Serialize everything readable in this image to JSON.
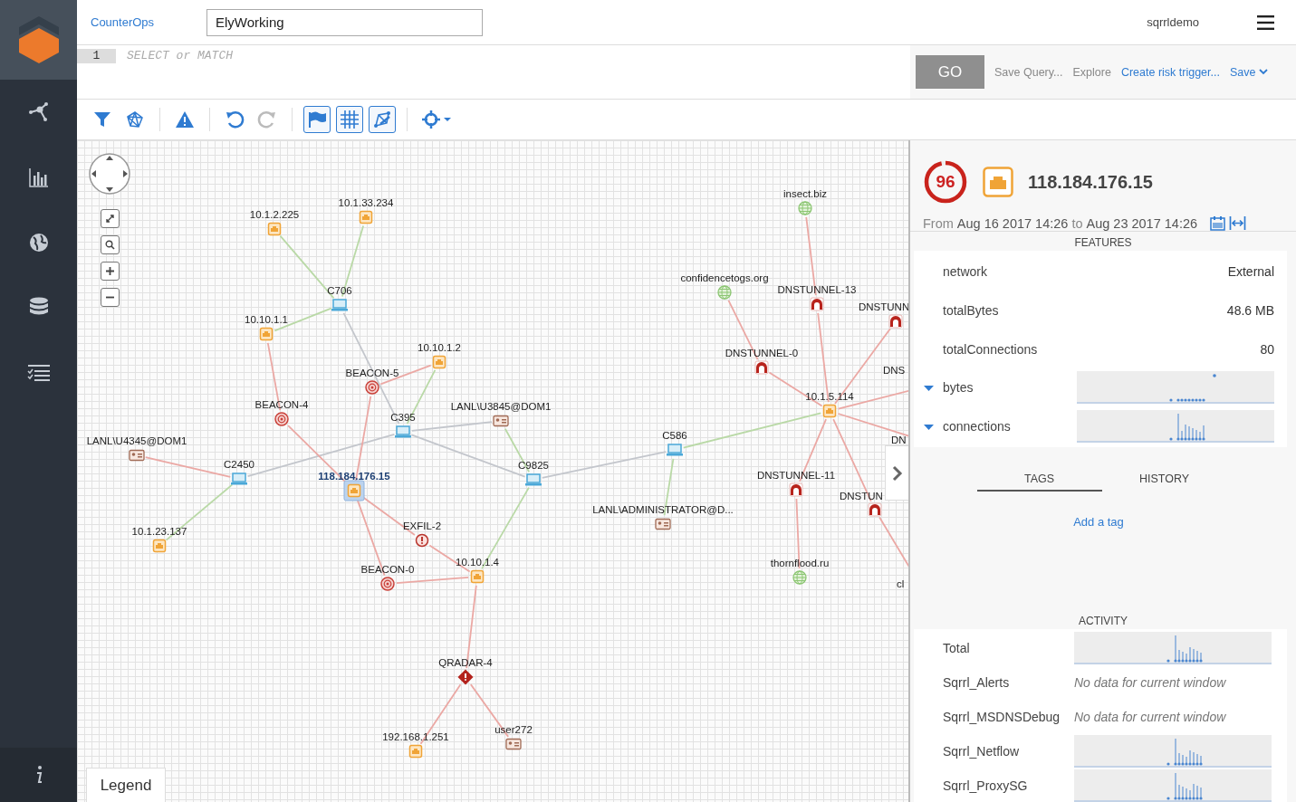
{
  "sidebar": {
    "items": [
      {
        "kind": "graph"
      },
      {
        "kind": "chart"
      },
      {
        "kind": "globe"
      },
      {
        "kind": "database"
      },
      {
        "kind": "list"
      },
      {
        "kind": "info"
      }
    ]
  },
  "header": {
    "app_link": "CounterOps",
    "workspace_field": {
      "value": "ElyWorking"
    },
    "user": "sqrrldemo"
  },
  "query": {
    "line_number": "1",
    "placeholder": "SELECT or MATCH",
    "actions": [
      {
        "label": "GO",
        "kind": "button",
        "disabled": true
      },
      {
        "label": "Save Query...",
        "kind": "link",
        "disabled": true
      },
      {
        "label": "Explore",
        "kind": "link",
        "disabled": true
      },
      {
        "label": "Create risk trigger...",
        "kind": "link",
        "disabled": false
      },
      {
        "label": "Save",
        "kind": "dropdown",
        "disabled": false
      }
    ]
  },
  "toolbar": [
    {
      "kind": "filter",
      "on": false,
      "disabled": false
    },
    {
      "kind": "layout",
      "on": false,
      "disabled": false
    },
    {
      "kind": "warning",
      "on": false,
      "disabled": false
    },
    {
      "kind": "undo",
      "on": false,
      "disabled": false
    },
    {
      "kind": "redo",
      "on": false,
      "disabled": true
    },
    {
      "kind": "flag",
      "on": true,
      "disabled": false
    },
    {
      "kind": "grid",
      "on": true,
      "disabled": false
    },
    {
      "kind": "edit",
      "on": true,
      "disabled": false
    },
    {
      "kind": "target",
      "on": false,
      "disabled": false
    }
  ],
  "graph": {
    "nodes": [
      {
        "label": "10.1.2.225",
        "kind": "host",
        "selected": false
      },
      {
        "label": "10.1.33.234",
        "kind": "host",
        "selected": false
      },
      {
        "label": "C706",
        "kind": "computer",
        "selected": false
      },
      {
        "label": "10.10.1.1",
        "kind": "host",
        "selected": false
      },
      {
        "label": "10.10.1.2",
        "kind": "host",
        "selected": false
      },
      {
        "label": "BEACON-5",
        "kind": "beacon",
        "selected": false
      },
      {
        "label": "BEACON-4",
        "kind": "beacon",
        "selected": false
      },
      {
        "label": "C395",
        "kind": "computer",
        "selected": false
      },
      {
        "label": "LANL\\U3845@DOM1",
        "kind": "user",
        "selected": false
      },
      {
        "label": "LANL\\U4345@DOM1",
        "kind": "user",
        "selected": false
      },
      {
        "label": "C2450",
        "kind": "computer",
        "selected": false
      },
      {
        "label": "118.184.176.15",
        "kind": "host",
        "selected": true
      },
      {
        "label": "C9825",
        "kind": "computer",
        "selected": false
      },
      {
        "label": "C586",
        "kind": "computer",
        "selected": false
      },
      {
        "label": "LANL\\ADMINISTRATOR@D...",
        "kind": "user",
        "selected": false
      },
      {
        "label": "EXFIL-2",
        "kind": "alert",
        "selected": false
      },
      {
        "label": "10.1.23.137",
        "kind": "host",
        "selected": false
      },
      {
        "label": "BEACON-0",
        "kind": "beacon",
        "selected": false
      },
      {
        "label": "10.10.1.4",
        "kind": "host",
        "selected": false
      },
      {
        "label": "QRADAR-4",
        "kind": "offense",
        "selected": false
      },
      {
        "label": "192.168.1.251",
        "kind": "host",
        "selected": false
      },
      {
        "label": "user272",
        "kind": "user",
        "selected": false
      },
      {
        "label": "insect.biz",
        "kind": "domain",
        "selected": false
      },
      {
        "label": "confidencetogs.org",
        "kind": "domain",
        "selected": false
      },
      {
        "label": "DNSTUNNEL-13",
        "kind": "tunnel",
        "selected": false
      },
      {
        "label": "DNSTUNN",
        "kind": "tunnel",
        "selected": false
      },
      {
        "label": "DNSTUNNEL-0",
        "kind": "tunnel",
        "selected": false
      },
      {
        "label": "DNS",
        "kind": "label",
        "selected": false
      },
      {
        "label": "10.1.5.114",
        "kind": "host",
        "selected": false
      },
      {
        "label": "DN",
        "kind": "label",
        "selected": false
      },
      {
        "label": "DNSTUNNEL-11",
        "kind": "tunnel",
        "selected": false
      },
      {
        "label": "DNSTUN",
        "kind": "tunnel",
        "selected": false
      },
      {
        "label": "thornflood.ru",
        "kind": "domain",
        "selected": false
      },
      {
        "label": "cl",
        "kind": "label",
        "selected": false
      }
    ],
    "legend_button": "Legend"
  },
  "details": {
    "score": {
      "value": "96",
      "level": 0.96
    },
    "title": "118.184.176.15",
    "date_range": {
      "prefix": "From",
      "start": "Aug 16 2017 14:26",
      "joiner": "to",
      "end": "Aug 23 2017 14:26"
    },
    "features": {
      "heading": "FEATURES",
      "rows": [
        {
          "label": "network",
          "kind": "value",
          "value": "External"
        },
        {
          "label": "totalBytes",
          "kind": "value",
          "value": "48.6 MB"
        },
        {
          "label": "totalConnections",
          "kind": "value",
          "value": "80"
        },
        {
          "label": "bytes",
          "kind": "sparkline",
          "expanded": true
        },
        {
          "label": "connections",
          "kind": "sparkline",
          "expanded": true
        }
      ]
    },
    "tabs": [
      {
        "label": "TAGS",
        "selected": true
      },
      {
        "label": "HISTORY",
        "selected": false
      }
    ],
    "add_tag_link": "Add a tag",
    "activity": {
      "heading": "ACTIVITY",
      "rows": [
        {
          "label": "Total",
          "kind": "sparkline"
        },
        {
          "label": "Sqrrl_Alerts",
          "kind": "empty",
          "note": "No data for current window"
        },
        {
          "label": "Sqrrl_MSDNSDebug",
          "kind": "empty",
          "note": "No data for current window"
        },
        {
          "label": "Sqrrl_Netflow",
          "kind": "sparkline"
        },
        {
          "label": "Sqrrl_ProxySG",
          "kind": "sparkline"
        }
      ]
    }
  }
}
